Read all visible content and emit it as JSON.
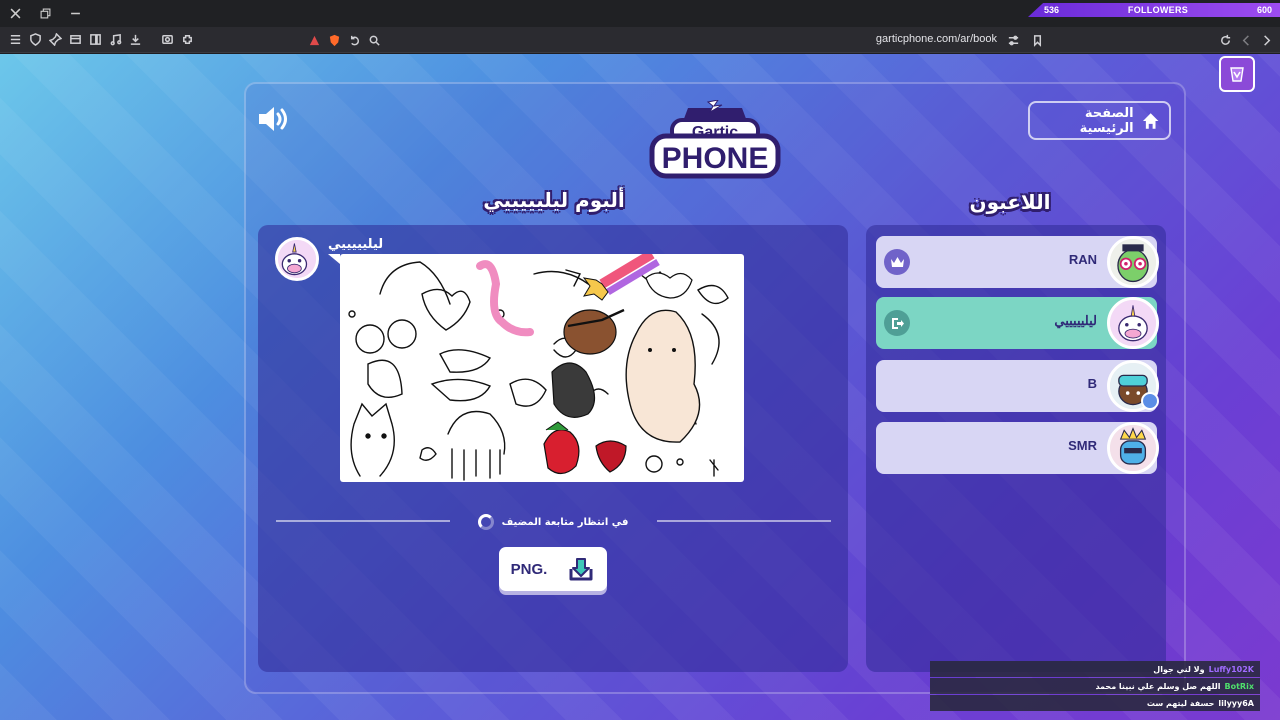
{
  "browser": {
    "url": "garticphone.com/ar/book",
    "followers_label": "FOLLOWERS",
    "followers_current": "536",
    "followers_goal": "600"
  },
  "header": {
    "home_label": "الصفحة الرئيسية",
    "logo_top": "Gartic",
    "logo_bottom": "PHONE"
  },
  "album": {
    "title": "ألبوم ليليييييي",
    "author": "ليليييييي",
    "waiting_text": "في انتظار متابعة المضيف",
    "png_label": "PNG."
  },
  "players": {
    "title": "اللاعبون",
    "list": [
      {
        "name": "RAN",
        "badge": "crown-icon"
      },
      {
        "name": "ليليييييي",
        "badge": "exit-icon"
      },
      {
        "name": "B",
        "badge": ""
      },
      {
        "name": "SMR",
        "badge": ""
      }
    ]
  },
  "chat": {
    "messages": [
      {
        "user": "Luffy102K",
        "text": "ولا لني جوال",
        "color": "#a06cff"
      },
      {
        "user": "BotRix",
        "text": "اللهم صل وسلم علي نبينا محمد",
        "color": "#4fe06c"
      },
      {
        "user": "lilyyy6A",
        "text": "حسفة ليتهم ست",
        "color": "#ffffff"
      }
    ]
  },
  "colors": {
    "panel": "#302a96",
    "player_row": "#d8d6f4",
    "player_active": "#7cd6c4",
    "accent_dark": "#302a78"
  }
}
